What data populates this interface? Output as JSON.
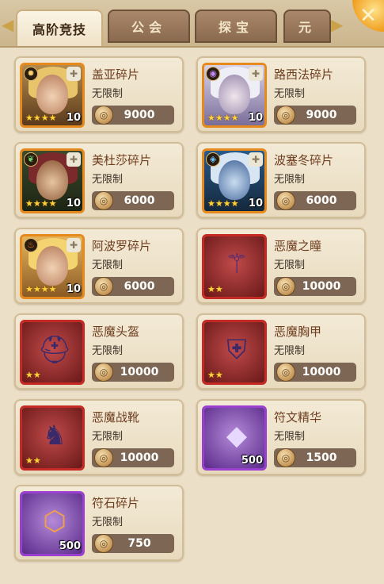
{
  "tabs": [
    {
      "label": "高阶竞技",
      "active": true
    },
    {
      "label": "公会",
      "active": false
    },
    {
      "label": "探宝",
      "active": false
    },
    {
      "label": "元",
      "active": false
    }
  ],
  "items": [
    {
      "name": "盖亚碎片",
      "limit": "无限制",
      "price": "9000",
      "stars": "★★★★",
      "count": "10",
      "frame": "orange"
    },
    {
      "name": "路西法碎片",
      "limit": "无限制",
      "price": "9000",
      "stars": "★★★★",
      "count": "10",
      "frame": "orange"
    },
    {
      "name": "美杜莎碎片",
      "limit": "无限制",
      "price": "6000",
      "stars": "★★★★",
      "count": "10",
      "frame": "orange"
    },
    {
      "name": "波塞冬碎片",
      "limit": "无限制",
      "price": "6000",
      "stars": "★★★★",
      "count": "10",
      "frame": "orange"
    },
    {
      "name": "阿波罗碎片",
      "limit": "无限制",
      "price": "6000",
      "stars": "★★★★",
      "count": "10",
      "frame": "orange"
    },
    {
      "name": "恶魔之瞳",
      "limit": "无限制",
      "price": "10000",
      "stars": "★★",
      "count": "",
      "frame": "red"
    },
    {
      "name": "恶魔头盔",
      "limit": "无限制",
      "price": "10000",
      "stars": "★★",
      "count": "",
      "frame": "red"
    },
    {
      "name": "恶魔胸甲",
      "limit": "无限制",
      "price": "10000",
      "stars": "★★",
      "count": "",
      "frame": "red"
    },
    {
      "name": "恶魔战靴",
      "limit": "无限制",
      "price": "10000",
      "stars": "★★",
      "count": "",
      "frame": "red"
    },
    {
      "name": "符文精华",
      "limit": "无限制",
      "price": "1500",
      "stars": "",
      "count": "500",
      "frame": "purple"
    },
    {
      "name": "符石碎片",
      "limit": "无限制",
      "price": "750",
      "stars": "",
      "count": "500",
      "frame": "purple"
    }
  ]
}
